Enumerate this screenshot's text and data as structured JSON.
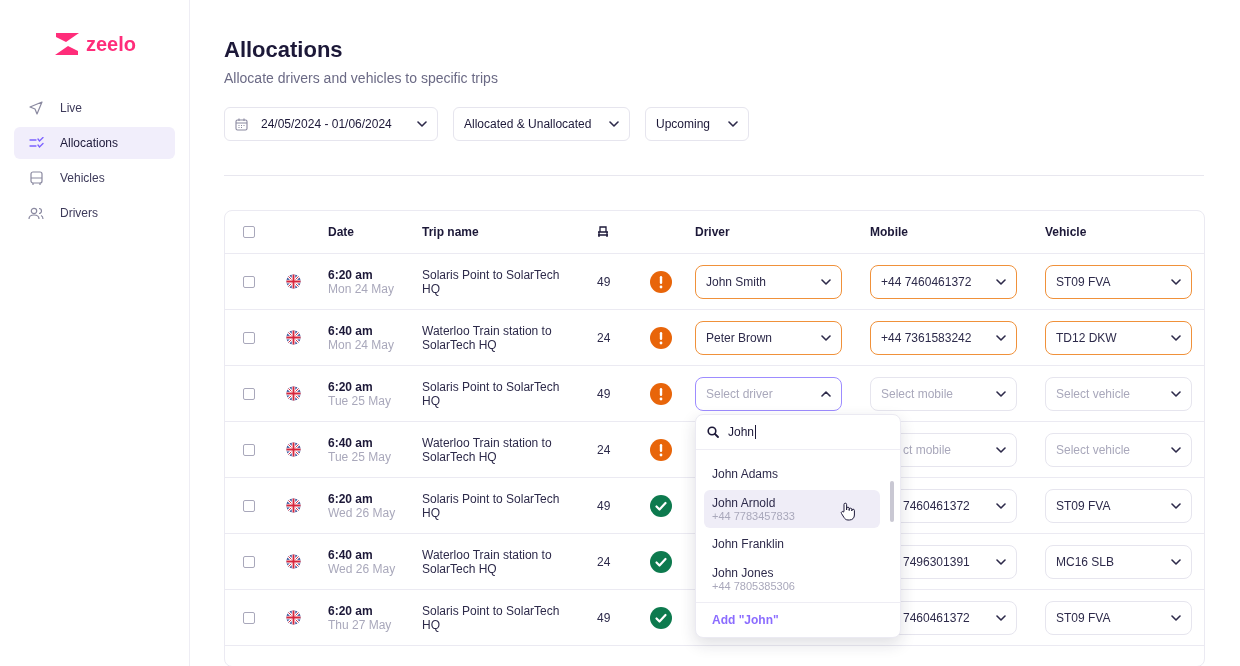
{
  "sidebar": {
    "logo": "zeelo",
    "items": [
      {
        "label": "Live",
        "selected": false
      },
      {
        "label": "Allocations",
        "selected": true
      },
      {
        "label": "Vehicles",
        "selected": false
      },
      {
        "label": "Drivers",
        "selected": false
      }
    ]
  },
  "page": {
    "title": "Allocations",
    "subtitle": "Allocate drivers and vehicles to specific trips"
  },
  "filters": [
    "24/05/2024 - 01/06/2024",
    "Allocated & Unallocated",
    "Upcoming"
  ],
  "table": {
    "select_all_checked": false,
    "columns": [
      "Date",
      "Trip name",
      "Driver",
      "Mobile",
      "Vehicle"
    ],
    "rows": [
      {
        "checked": false,
        "time": "6:20 am",
        "day": "Mon 24 May",
        "trip": "Solaris Point to SolarTech HQ",
        "seats": "49",
        "allocated": false,
        "driver": {
          "value": "John Smith",
          "warning": true
        },
        "mobile": {
          "value": "+44 7460461372",
          "warning": true
        },
        "vehicle": {
          "value": "ST09 FVA",
          "warning": true
        }
      },
      {
        "checked": false,
        "time": "6:40 am",
        "day": "Mon 24 May",
        "trip": "Waterloo Train station to SolarTech HQ",
        "seats": "24",
        "allocated": false,
        "driver": {
          "value": "Peter Brown",
          "warning": true
        },
        "mobile": {
          "value": "+44 7361583242",
          "warning": true
        },
        "vehicle": {
          "value": "TD12 DKW",
          "warning": true
        }
      },
      {
        "checked": false,
        "time": "6:20 am",
        "day": "Tue 25 May",
        "trip": "Solaris Point to SolarTech HQ",
        "seats": "49",
        "allocated": false,
        "driver": {
          "placeholder": "Select driver",
          "open": true
        },
        "mobile": {
          "placeholder": "Select mobile"
        },
        "vehicle": {
          "placeholder": "Select vehicle"
        }
      },
      {
        "checked": false,
        "time": "6:40 am",
        "day": "Tue 25 May",
        "trip": "Waterloo Train station to SolarTech HQ",
        "seats": "24",
        "allocated": false,
        "mobile": {
          "placeholder": "ct mobile",
          "partial": true
        },
        "vehicle": {
          "placeholder": "Select vehicle"
        }
      },
      {
        "checked": false,
        "time": "6:20 am",
        "day": "Wed 26 May",
        "trip": "Solaris Point to SolarTech HQ",
        "seats": "49",
        "allocated": true,
        "mobile": {
          "value": "7460461372",
          "partial": true
        },
        "vehicle": {
          "value": "ST09 FVA"
        }
      },
      {
        "checked": false,
        "time": "6:40 am",
        "day": "Wed 26 May",
        "trip": "Waterloo Train station to SolarTech HQ",
        "seats": "24",
        "allocated": true,
        "mobile": {
          "value": "7496301391",
          "partial": true
        },
        "vehicle": {
          "value": "MC16 SLB"
        }
      },
      {
        "checked": false,
        "time": "6:20 am",
        "day": "Thu 27 May",
        "trip": "Solaris Point to SolarTech HQ",
        "seats": "49",
        "allocated": true,
        "mobile": {
          "value": "7460461372",
          "partial": true
        },
        "vehicle": {
          "value": "ST09 FVA"
        }
      }
    ]
  },
  "driver_dropdown": {
    "query": "John",
    "options": [
      {
        "name": "John Adams",
        "selected": false
      },
      {
        "name": "John Arnold",
        "phone": "+44 7783457833",
        "selected": true
      },
      {
        "name": "John Franklin",
        "selected": false
      },
      {
        "name": "John Jones",
        "phone": "+44 7805385306",
        "selected": false
      }
    ],
    "add_label": "Add \"John\""
  }
}
